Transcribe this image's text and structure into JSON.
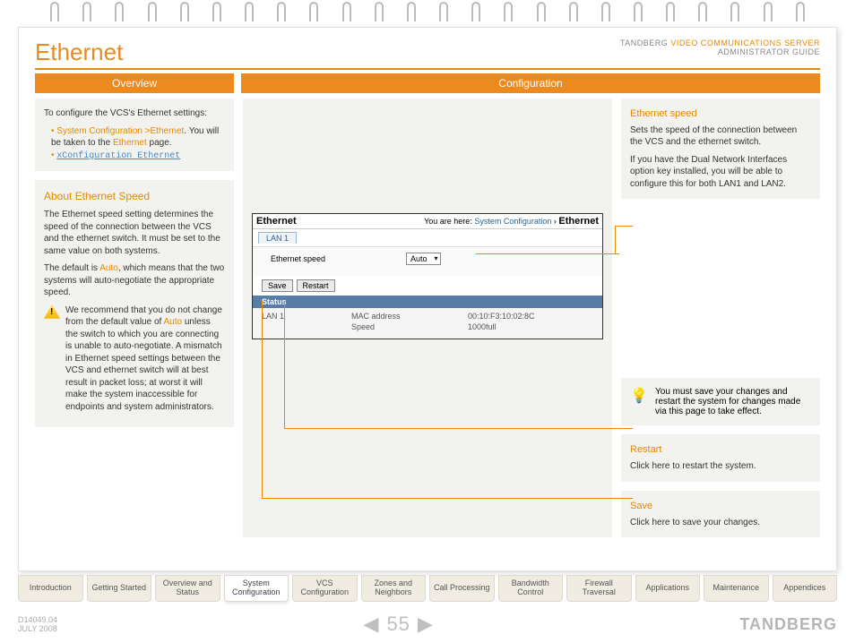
{
  "header": {
    "title": "Ethernet",
    "brand_prefix": "TANDBERG",
    "brand_product": "VIDEO COMMUNICATIONS SERVER",
    "brand_sub": "ADMINISTRATOR GUIDE"
  },
  "tabs": {
    "overview": "Overview",
    "configuration": "Configuration"
  },
  "left": {
    "intro": "To configure the VCS's Ethernet settings:",
    "nav_path": "System Configuration >Ethernet",
    "nav_suffix": ". You will be taken to the ",
    "nav_link_word": "Ethernet",
    "nav_suffix2": " page.",
    "cli_link": "xConfiguration Ethernet",
    "about_title": "About Ethernet Speed",
    "p1": "The Ethernet speed setting determines the speed of the connection between the VCS and the ethernet switch.  It must be set to the same value on both systems.",
    "p2a": "The default is ",
    "p2auto": "Auto",
    "p2b": ", which means that the two systems will auto-negotiate the appropriate speed.",
    "warn_a": "We recommend that you do not change from the default value of ",
    "warn_auto": "Auto",
    "warn_b": " unless the switch to which you are connecting is unable to auto-negotiate.  A mismatch in Ethernet speed settings between the VCS and ethernet switch will at best result in packet loss; at worst it will make the system inaccessible for endpoints and system administrators."
  },
  "screenshot": {
    "title": "Ethernet",
    "breadcrumb_pre": "You are here: ",
    "breadcrumb1": "System Configuration",
    "breadcrumb_sep": " › ",
    "breadcrumb2": "Ethernet",
    "tab": "LAN 1",
    "field_label": "Ethernet speed",
    "field_value": "Auto",
    "save": "Save",
    "restart": "Restart",
    "status": "Status",
    "row_lan": "LAN 1",
    "mac_label": "MAC address",
    "mac_value": "00:10:F3:10:02:8C",
    "speed_label": "Speed",
    "speed_value": "1000full"
  },
  "right": {
    "speed_title": "Ethernet speed",
    "speed_p1": "Sets the speed of the connection between the VCS and the ethernet switch.",
    "speed_p2": "If you have the Dual Network Interfaces option key installed, you will be able to configure this for both LAN1 and LAN2.",
    "tip": "You must save your changes and restart the system for changes made via this page to take effect.",
    "restart_title": "Restart",
    "restart_body": "Click here to restart the system.",
    "save_title": "Save",
    "save_body": "Click here to save your changes."
  },
  "nav": [
    "Introduction",
    "Getting Started",
    "Overview and Status",
    "System Configuration",
    "VCS Configuration",
    "Zones and Neighbors",
    "Call Processing",
    "Bandwidth Control",
    "Firewall Traversal",
    "Applications",
    "Maintenance",
    "Appendices"
  ],
  "footer": {
    "doc": "D14049.04",
    "date": "JULY 2008",
    "page": "55",
    "brand": "TANDBERG"
  }
}
